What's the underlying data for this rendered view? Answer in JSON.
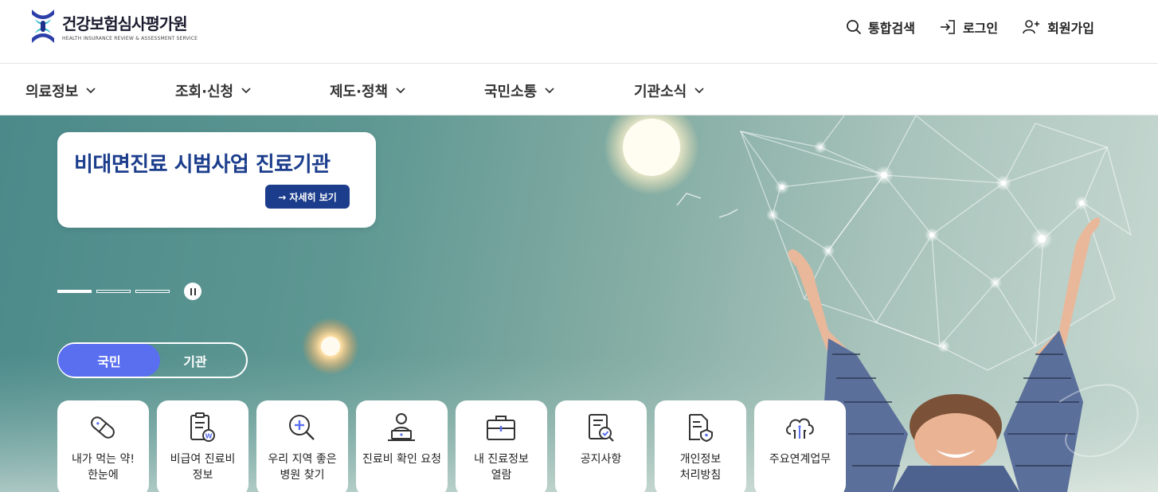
{
  "header": {
    "logo_ko": "건강보험심사평가원",
    "logo_en": "HEALTH INSURANCE REVIEW & ASSESSMENT SERVICE",
    "util": [
      {
        "label": "통합검색",
        "icon": "search-icon"
      },
      {
        "label": "로그인",
        "icon": "login-icon"
      },
      {
        "label": "회원가입",
        "icon": "user-add-icon"
      }
    ]
  },
  "gnb": {
    "items": [
      {
        "label": "의료정보"
      },
      {
        "label": "조회·신청"
      },
      {
        "label": "제도·정책"
      },
      {
        "label": "국민소통"
      },
      {
        "label": "기관소식"
      }
    ]
  },
  "hero": {
    "promo_title": "비대면진료 시범사업 진료기관",
    "promo_button": "→ 자세히 보기",
    "slides_total": 3,
    "slide_active": 1,
    "toggle": {
      "selected": "국민",
      "other": "기관"
    }
  },
  "tiles": [
    {
      "label": "내가 먹는 약!\n한눈에",
      "icon": "pill-icon"
    },
    {
      "label": "비급여 진료비\n정보",
      "icon": "won-document-icon"
    },
    {
      "label": "우리 지역 좋은\n병원 찾기",
      "icon": "hospital-search-icon"
    },
    {
      "label": "진료비 확인 요청",
      "icon": "laptop-user-icon"
    },
    {
      "label": "내 진료정보\n열람",
      "icon": "medical-briefcase-icon"
    },
    {
      "label": "공지사항",
      "icon": "notice-document-icon"
    },
    {
      "label": "개인정보\n처리방침",
      "icon": "privacy-shield-icon"
    },
    {
      "label": "주요연계업무",
      "icon": "cloud-network-icon"
    }
  ],
  "colors": {
    "brand": "#1b3d8c",
    "toggle_active": "#5a6ff0",
    "icon": "#333333",
    "icon_accent": "#5a6ff0"
  }
}
